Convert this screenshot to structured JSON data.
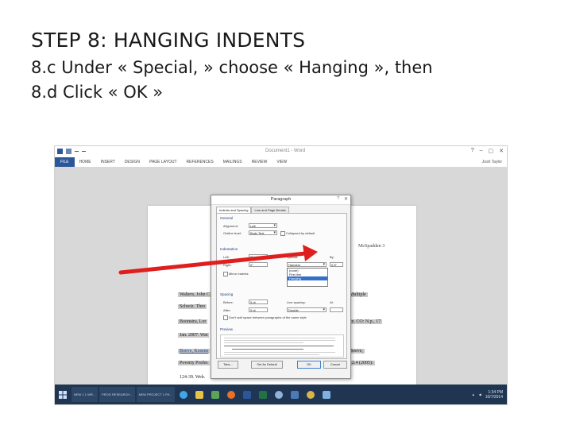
{
  "slide": {
    "title": "STEP 8: HANGING INDENTS",
    "line1": "8.c Under « Special, » choose « Hanging », then",
    "line2": "8.d Click « OK »"
  },
  "word": {
    "tabs": [
      "FILE",
      "HOME",
      "INSERT",
      "DESIGN",
      "PAGE LAYOUT",
      "REFERENCES",
      "MAILINGS",
      "REVIEW",
      "VIEW"
    ],
    "document_title": "Document1 - Word",
    "user": "Josh Taylor",
    "page_header": "McSpadden 3",
    "citations": [
      "Walters, John C",
      "Schwiz. Thro",
      "Boonstra, Lor",
      "Jan. 2007. Wat",
      "Boeve, Kosene",
      "Poverty Profes",
      "124-39. Web."
    ],
    "right_fragments": [
      "Multiple",
      "ce. CO: N.p., 17",
      "Boeve,",
      "12.4 (2005):"
    ]
  },
  "dialog": {
    "title": "Paragraph",
    "help": "?",
    "close": "✕",
    "tabs": [
      "Indents and Spacing",
      "Line and Page Breaks"
    ],
    "general": {
      "heading": "General",
      "alignment_label": "Alignment:",
      "alignment_value": "Left",
      "outline_label": "Outline level:",
      "outline_value": "Body Text",
      "collapsed_label": "Collapsed by default"
    },
    "indentation": {
      "heading": "Indentation",
      "left_label": "Left:",
      "left_value": "0\"",
      "right_label": "Right:",
      "right_value": "0\"",
      "mirror_label": "Mirror indents",
      "special_label": "Special:",
      "special_value": "Hanging",
      "by_label": "By:",
      "by_value": "0.5\"",
      "special_options": [
        "(none)",
        "First line",
        "Hanging"
      ],
      "special_selected": "Hanging"
    },
    "spacing": {
      "heading": "Spacing",
      "before_label": "Before:",
      "before_value": "0 pt",
      "after_label": "After:",
      "after_value": "0 pt",
      "line_label": "Line spacing:",
      "line_value": "Double",
      "at_label": "At:",
      "dont_add_label": "Don't add space between paragraphs of the same style"
    },
    "preview_heading": "Preview",
    "buttons": {
      "tabs": "Tabs...",
      "default": "Set As Default",
      "ok": "OK",
      "cancel": "Cancel"
    }
  },
  "taskbar": {
    "items": [
      "NEW 1.1 WR...",
      "PROG RESEARCH...",
      "NEW PROJECT 1 FH..."
    ],
    "time": "1:34 PM",
    "date": "10/7/2014"
  },
  "colors": {
    "word_blue": "#2b579a",
    "selection_blue": "#3370c8",
    "arrow_red": "#e01e1e",
    "taskbar": "#1f3551"
  }
}
